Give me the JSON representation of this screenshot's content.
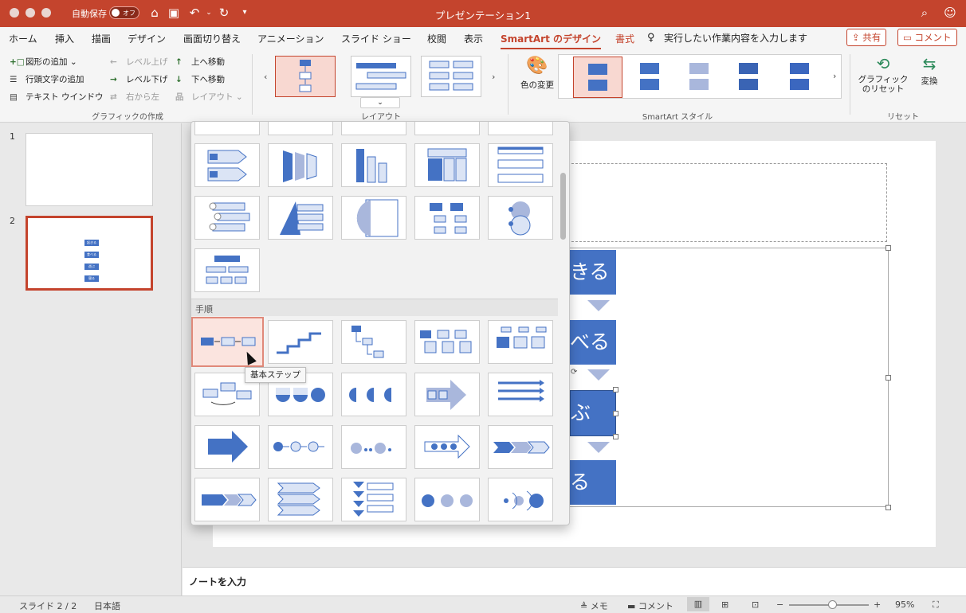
{
  "window": {
    "title": "プレゼンテーション1",
    "autosave_label": "自動保存",
    "autosave_state": "オフ"
  },
  "tabs": [
    {
      "label": "ホーム"
    },
    {
      "label": "挿入"
    },
    {
      "label": "描画"
    },
    {
      "label": "デザイン"
    },
    {
      "label": "画面切り替え"
    },
    {
      "label": "アニメーション"
    },
    {
      "label": "スライド ショー"
    },
    {
      "label": "校閲"
    },
    {
      "label": "表示"
    },
    {
      "label": "SmartArt のデザイン"
    },
    {
      "label": "書式"
    }
  ],
  "tell_me": "実行したい作業内容を入力します",
  "share_label": "共有",
  "comments_label": "コメント",
  "ribbon": {
    "create_graphic": {
      "add_shape": "図形の追加",
      "add_bullet": "行頭文字の追加",
      "text_pane": "テキスト ウインドウ",
      "promote": "レベル上げ",
      "demote": "レベル下げ",
      "right_to_left": "右から左",
      "move_up": "上へ移動",
      "move_down": "下へ移動",
      "layout": "レイアウト",
      "group_label": "グラフィックの作成"
    },
    "layouts_label": "レイアウト",
    "change_colors": "色の変更",
    "styles_label": "SmartArt スタイル",
    "reset_graphic": "グラフィック のリセット",
    "convert": "変換",
    "reset_label": "リセット"
  },
  "slides": [
    {
      "number": "1"
    },
    {
      "number": "2",
      "thumb_items": [
        "起きる",
        "食べる",
        "遊ぶ",
        "寝る"
      ]
    }
  ],
  "slide_content": {
    "boxes": [
      "起きる",
      "食べる",
      "遊ぶ",
      "寝る"
    ],
    "visible_fragments": [
      "きる",
      "べる",
      "ぶ",
      "る"
    ]
  },
  "gallery": {
    "section_label": "手順",
    "tooltip": "基本ステップ"
  },
  "notes_placeholder": "ノートを入力",
  "status": {
    "slide_info": "スライド 2 / 2",
    "language": "日本語",
    "notes_btn": "メモ",
    "comments_btn": "コメント",
    "zoom": "95%",
    "zoom_value": 0.55
  },
  "colors": {
    "accent": "#c4442d",
    "smartart": "#4472c4"
  }
}
